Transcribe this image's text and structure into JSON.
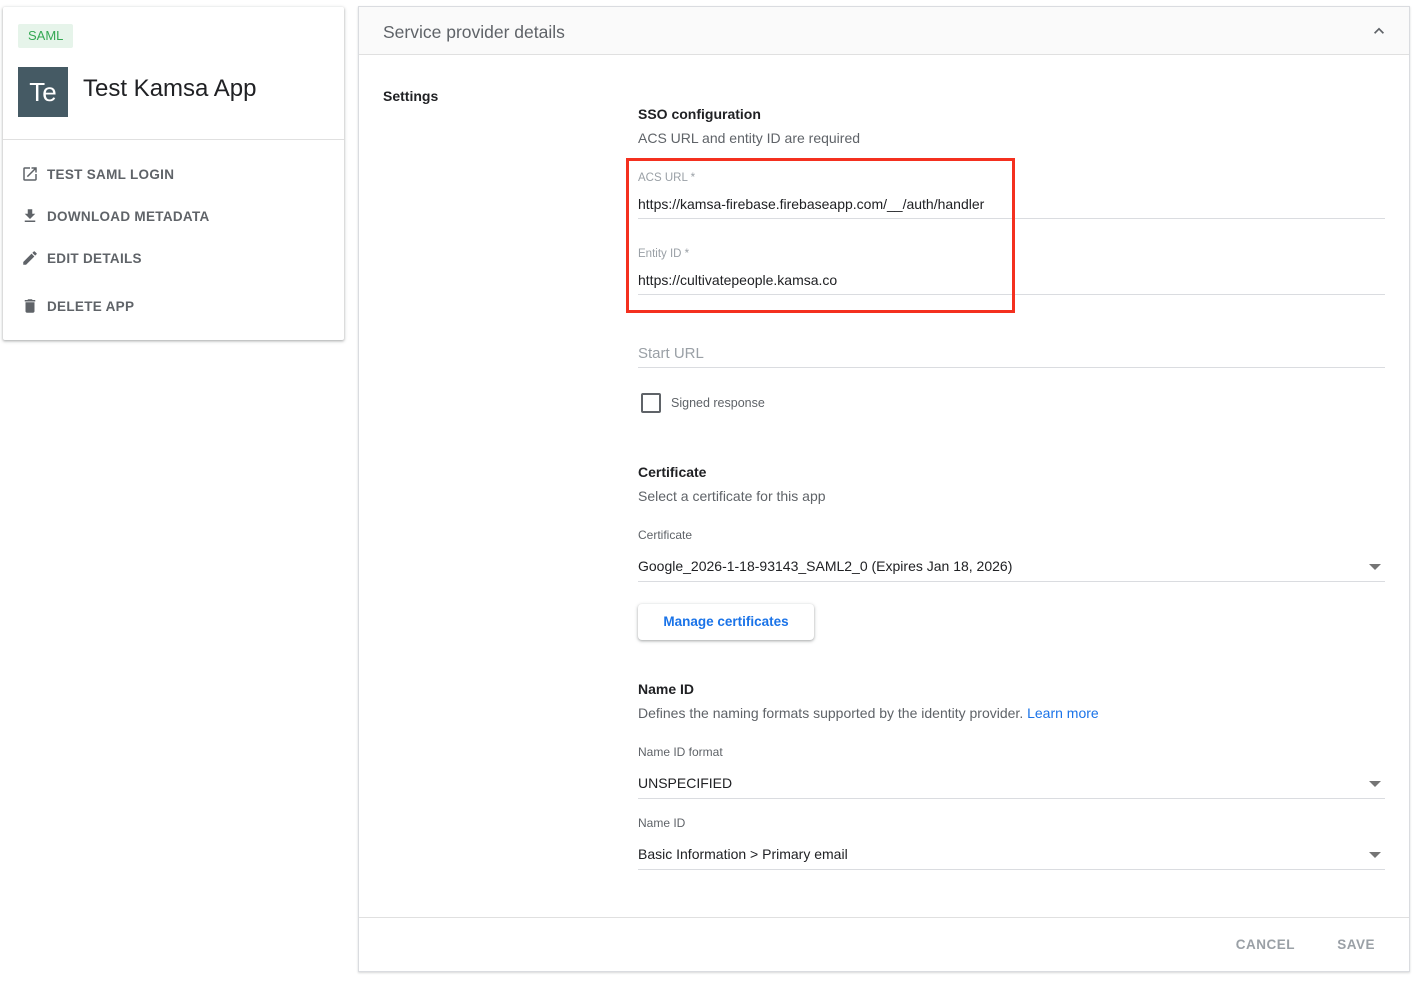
{
  "app": {
    "badge": "SAML",
    "avatar_text": "Te",
    "name": "Test Kamsa App",
    "actions": [
      {
        "label": "TEST SAML LOGIN",
        "icon": "open-in-new-icon"
      },
      {
        "label": "DOWNLOAD METADATA",
        "icon": "download-icon"
      },
      {
        "label": "EDIT DETAILS",
        "icon": "pencil-icon"
      },
      {
        "label": "DELETE APP",
        "icon": "trash-icon"
      }
    ]
  },
  "panel": {
    "title": "Service provider details",
    "settings_label": "Settings",
    "sso": {
      "title": "SSO configuration",
      "subtitle": "ACS URL and entity ID are required",
      "acs_label": "ACS URL *",
      "acs_value": "https://kamsa-firebase.firebaseapp.com/__/auth/handler",
      "entity_label": "Entity ID *",
      "entity_value": "https://cultivatepeople.kamsa.co",
      "start_url_placeholder": "Start URL",
      "signed_response_label": "Signed response",
      "signed_response_checked": false
    },
    "certificate": {
      "title": "Certificate",
      "subtitle": "Select a certificate for this app",
      "field_label": "Certificate",
      "selected": "Google_2026-1-18-93143_SAML2_0 (Expires Jan 18, 2026)",
      "manage_button": "Manage certificates"
    },
    "name_id": {
      "title": "Name ID",
      "subtitle": "Defines the naming formats supported by the identity provider.",
      "learn_more": "Learn more",
      "format_label": "Name ID format",
      "format_value": "UNSPECIFIED",
      "name_id_label": "Name ID",
      "name_id_value": "Basic Information > Primary email"
    },
    "footer": {
      "cancel": "CANCEL",
      "save": "SAVE"
    }
  },
  "colors": {
    "accent": "#1a73e8",
    "highlight": "#f4301f",
    "badge_bg": "#e6f4ea",
    "badge_text": "#34a853",
    "avatar_bg": "#455a64"
  }
}
